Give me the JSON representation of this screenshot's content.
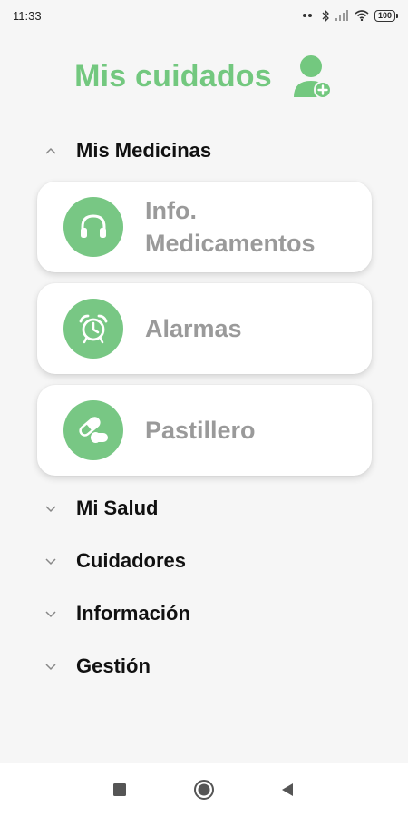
{
  "status_bar": {
    "time": "11:33",
    "battery": "100"
  },
  "header": {
    "title": "Mis cuidados",
    "profile_icon": "user-plus-icon"
  },
  "colors": {
    "accent": "#73c87f",
    "card_text": "#9a9a9a",
    "background": "#f6f6f6"
  },
  "sections": [
    {
      "label": "Mis Medicinas",
      "expanded": true
    },
    {
      "label": "Mi Salud",
      "expanded": false
    },
    {
      "label": "Cuidadores",
      "expanded": false
    },
    {
      "label": "Información",
      "expanded": false
    },
    {
      "label": "Gestión",
      "expanded": false
    }
  ],
  "cards": [
    {
      "label": "Info.\nMedicamentos",
      "icon": "headphones-icon"
    },
    {
      "label": "Alarmas",
      "icon": "alarm-clock-icon"
    },
    {
      "label": "Pastillero",
      "icon": "pills-icon"
    }
  ],
  "navbar": {
    "icons": [
      "square-icon",
      "home-circle-icon",
      "back-triangle-icon"
    ]
  }
}
